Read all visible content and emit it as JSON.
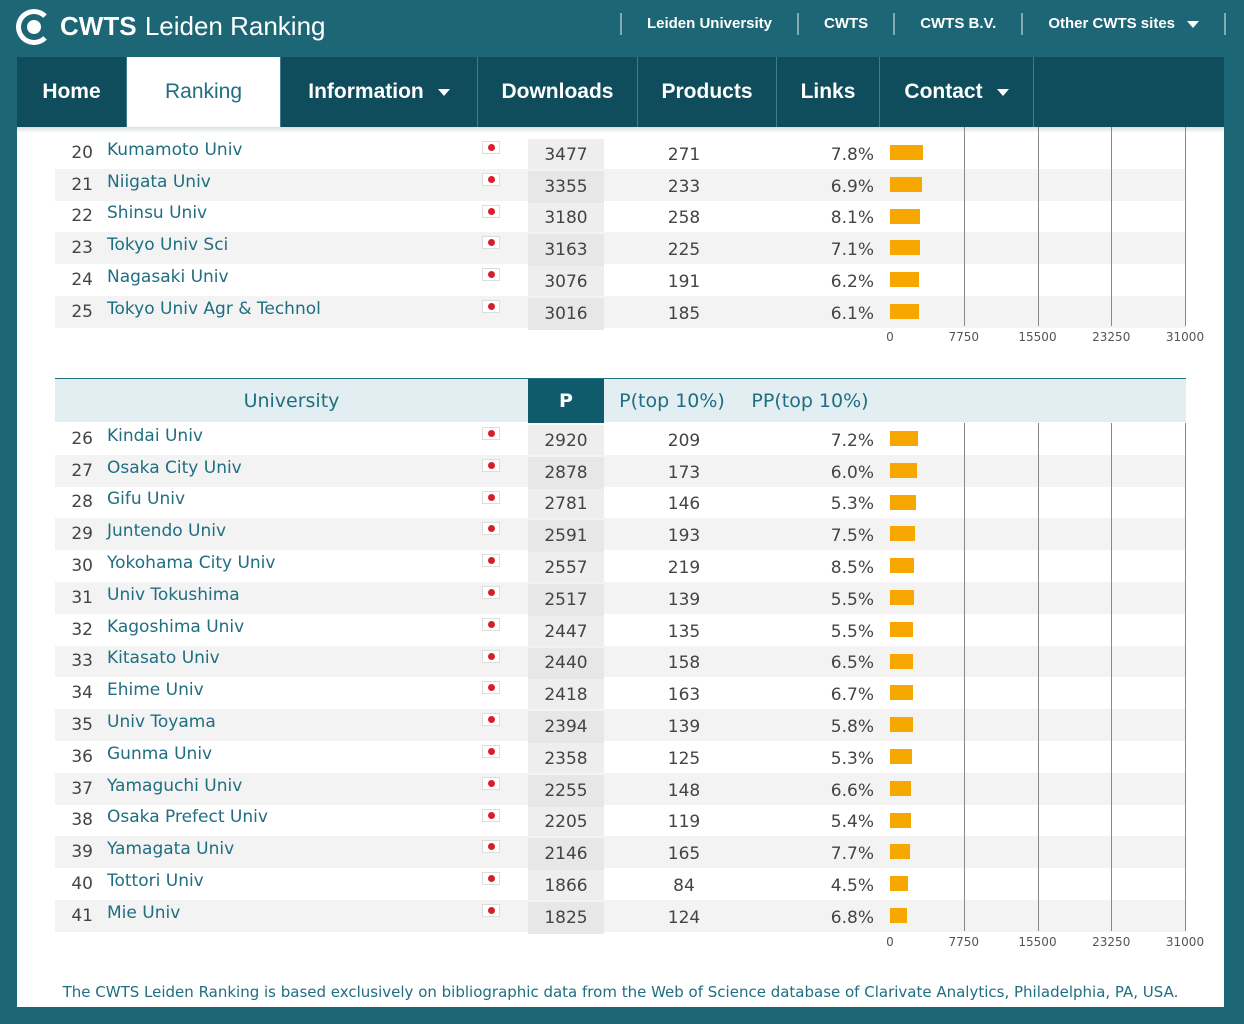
{
  "site": {
    "brand_bold": "CWTS",
    "brand_rest": "Leiden Ranking"
  },
  "toplinks": [
    {
      "label": "Leiden University"
    },
    {
      "label": "CWTS"
    },
    {
      "label": "CWTS B.V."
    },
    {
      "label": "Other CWTS sites"
    }
  ],
  "nav": [
    {
      "label": "Home"
    },
    {
      "label": "Ranking"
    },
    {
      "label": "Information"
    },
    {
      "label": "Downloads"
    },
    {
      "label": "Products"
    },
    {
      "label": "Links"
    },
    {
      "label": "Contact"
    }
  ],
  "table_header": {
    "university": "University",
    "p": "P",
    "p_top10": "P(top 10%)",
    "pp_top10": "PP(top 10%)"
  },
  "axis_ticks": [
    "0",
    "7750",
    "15500",
    "23250",
    "31000"
  ],
  "axis_max": 31000,
  "colors": {
    "bar": "#f7a800",
    "accent": "#1f6e81"
  },
  "rows_upper": [
    {
      "rank": "20",
      "name": "Kumamoto Univ",
      "p": "3477",
      "p_top10": "271",
      "pp_top10": "7.8%",
      "value": 3477
    },
    {
      "rank": "21",
      "name": "Niigata Univ",
      "p": "3355",
      "p_top10": "233",
      "pp_top10": "6.9%",
      "value": 3355
    },
    {
      "rank": "22",
      "name": "Shinsu Univ",
      "p": "3180",
      "p_top10": "258",
      "pp_top10": "8.1%",
      "value": 3180
    },
    {
      "rank": "23",
      "name": "Tokyo Univ Sci",
      "p": "3163",
      "p_top10": "225",
      "pp_top10": "7.1%",
      "value": 3163
    },
    {
      "rank": "24",
      "name": "Nagasaki Univ",
      "p": "3076",
      "p_top10": "191",
      "pp_top10": "6.2%",
      "value": 3076
    },
    {
      "rank": "25",
      "name": "Tokyo Univ Agr & Technol",
      "p": "3016",
      "p_top10": "185",
      "pp_top10": "6.1%",
      "value": 3016
    }
  ],
  "rows_lower": [
    {
      "rank": "26",
      "name": "Kindai Univ",
      "p": "2920",
      "p_top10": "209",
      "pp_top10": "7.2%",
      "value": 2920
    },
    {
      "rank": "27",
      "name": "Osaka City Univ",
      "p": "2878",
      "p_top10": "173",
      "pp_top10": "6.0%",
      "value": 2878
    },
    {
      "rank": "28",
      "name": "Gifu Univ",
      "p": "2781",
      "p_top10": "146",
      "pp_top10": "5.3%",
      "value": 2781
    },
    {
      "rank": "29",
      "name": "Juntendo Univ",
      "p": "2591",
      "p_top10": "193",
      "pp_top10": "7.5%",
      "value": 2591
    },
    {
      "rank": "30",
      "name": "Yokohama City Univ",
      "p": "2557",
      "p_top10": "219",
      "pp_top10": "8.5%",
      "value": 2557
    },
    {
      "rank": "31",
      "name": "Univ Tokushima",
      "p": "2517",
      "p_top10": "139",
      "pp_top10": "5.5%",
      "value": 2517
    },
    {
      "rank": "32",
      "name": "Kagoshima Univ",
      "p": "2447",
      "p_top10": "135",
      "pp_top10": "5.5%",
      "value": 2447
    },
    {
      "rank": "33",
      "name": "Kitasato Univ",
      "p": "2440",
      "p_top10": "158",
      "pp_top10": "6.5%",
      "value": 2440
    },
    {
      "rank": "34",
      "name": "Ehime Univ",
      "p": "2418",
      "p_top10": "163",
      "pp_top10": "6.7%",
      "value": 2418
    },
    {
      "rank": "35",
      "name": "Univ Toyama",
      "p": "2394",
      "p_top10": "139",
      "pp_top10": "5.8%",
      "value": 2394
    },
    {
      "rank": "36",
      "name": "Gunma Univ",
      "p": "2358",
      "p_top10": "125",
      "pp_top10": "5.3%",
      "value": 2358
    },
    {
      "rank": "37",
      "name": "Yamaguchi Univ",
      "p": "2255",
      "p_top10": "148",
      "pp_top10": "6.6%",
      "value": 2255
    },
    {
      "rank": "38",
      "name": "Osaka Prefect Univ",
      "p": "2205",
      "p_top10": "119",
      "pp_top10": "5.4%",
      "value": 2205
    },
    {
      "rank": "39",
      "name": "Yamagata Univ",
      "p": "2146",
      "p_top10": "165",
      "pp_top10": "7.7%",
      "value": 2146
    },
    {
      "rank": "40",
      "name": "Tottori Univ",
      "p": "1866",
      "p_top10": "84",
      "pp_top10": "4.5%",
      "value": 1866
    },
    {
      "rank": "41",
      "name": "Mie Univ",
      "p": "1825",
      "p_top10": "124",
      "pp_top10": "6.8%",
      "value": 1825
    }
  ],
  "footer": "The CWTS Leiden Ranking is based exclusively on bibliographic data from the Web of Science database of Clarivate Analytics, Philadelphia, PA, USA."
}
